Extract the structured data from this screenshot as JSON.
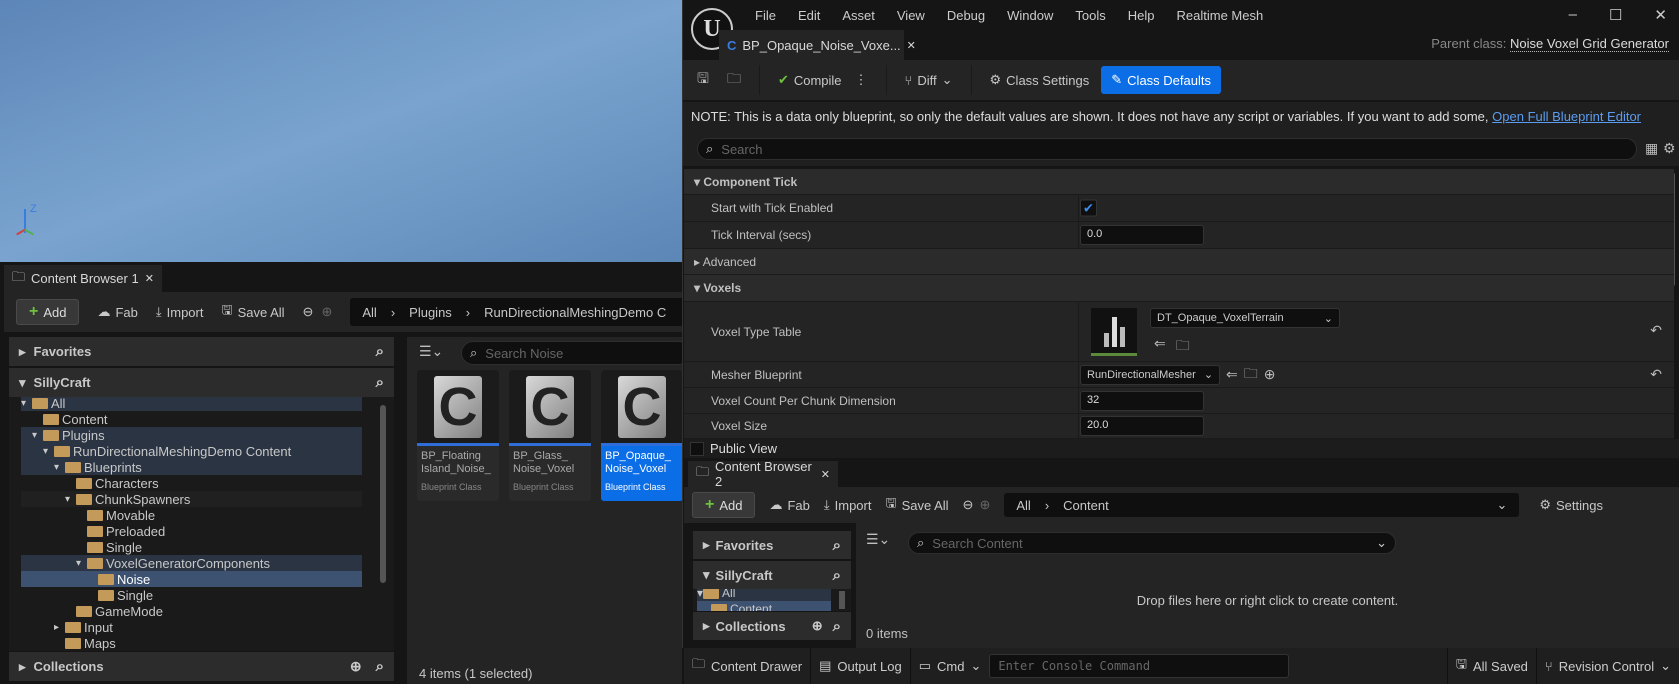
{
  "viewport": {
    "axis_label": "Z"
  },
  "cb1": {
    "tab": "Content Browser 1",
    "toolbar": {
      "add": "Add",
      "fab": "Fab",
      "import": "Import",
      "save_all": "Save All"
    },
    "breadcrumb": [
      "All",
      "Plugins",
      "RunDirectionalMeshingDemo C"
    ],
    "favorites": "Favorites",
    "project": "SillyCraft",
    "collections": "Collections",
    "tree": [
      {
        "label": "All",
        "depth": 0,
        "open": true,
        "hl": true
      },
      {
        "label": "Content",
        "depth": 1,
        "open": false,
        "hl": false
      },
      {
        "label": "Plugins",
        "depth": 1,
        "open": true,
        "hl": true
      },
      {
        "label": "RunDirectionalMeshingDemo Content",
        "depth": 2,
        "open": true,
        "hl": true
      },
      {
        "label": "Blueprints",
        "depth": 3,
        "open": true,
        "hl": true
      },
      {
        "label": "Characters",
        "depth": 4,
        "open": false,
        "hl": false
      },
      {
        "label": "ChunkSpawners",
        "depth": 4,
        "open": true,
        "hl": false,
        "dim": true
      },
      {
        "label": "Movable",
        "depth": 5,
        "open": false,
        "hl": false
      },
      {
        "label": "Preloaded",
        "depth": 5,
        "open": false,
        "hl": false
      },
      {
        "label": "Single",
        "depth": 5,
        "open": false,
        "hl": false
      },
      {
        "label": "VoxelGeneratorComponents",
        "depth": 5,
        "open": true,
        "hl": true
      },
      {
        "label": "Noise",
        "depth": 6,
        "open": false,
        "sel": true
      },
      {
        "label": "Single",
        "depth": 6,
        "open": false,
        "hl": false
      },
      {
        "label": "GameMode",
        "depth": 4,
        "open": false,
        "hl": false
      },
      {
        "label": "Input",
        "depth": 3,
        "open": false,
        "hl": false,
        "collapsed": true
      },
      {
        "label": "Maps",
        "depth": 3,
        "open": false,
        "hl": false
      }
    ],
    "search_placeholder": "Search Noise",
    "assets": [
      {
        "name": "BP_Floating Island_Noise_",
        "type": "Blueprint Class",
        "selected": false
      },
      {
        "name": "BP_Glass_ Noise_Voxel",
        "type": "Blueprint Class",
        "selected": false
      },
      {
        "name": "BP_Opaque_ Noise_Voxel",
        "type": "Blueprint Class",
        "selected": true
      }
    ],
    "status": "4 items (1 selected)"
  },
  "editor": {
    "menu": [
      "File",
      "Edit",
      "Asset",
      "View",
      "Debug",
      "Window",
      "Tools",
      "Help",
      "Realtime Mesh"
    ],
    "doc_tab": "BP_Opaque_Noise_Voxe...",
    "parent_label": "Parent class:",
    "parent_value": "Noise Voxel Grid Generator",
    "toolbar": {
      "compile": "Compile",
      "diff": "Diff",
      "class_settings": "Class Settings",
      "class_defaults": "Class Defaults"
    },
    "note": "NOTE: This is a data only blueprint, so only the default values are shown.  It does not have any script or variables.  If you want to add some,",
    "note_link": "Open Full Blueprint Editor",
    "search_placeholder": "Search",
    "sections": {
      "component_tick": "Component Tick",
      "advanced": "Advanced",
      "voxels": "Voxels"
    },
    "props": {
      "start_tick": {
        "label": "Start with Tick Enabled",
        "checked": true
      },
      "tick_interval": {
        "label": "Tick Interval (secs)",
        "value": "0.0"
      },
      "voxel_type_table": {
        "label": "Voxel Type Table",
        "value": "DT_Opaque_VoxelTerrain"
      },
      "mesher": {
        "label": "Mesher Blueprint",
        "value": "RunDirectionalMesher"
      },
      "voxel_count": {
        "label": "Voxel Count Per Chunk Dimension",
        "value": "32"
      },
      "voxel_size": {
        "label": "Voxel Size",
        "value": "20.0"
      }
    },
    "public_view": "Public View",
    "accent": "#0b6ee6"
  },
  "cb2": {
    "tab": "Content Browser 2",
    "toolbar": {
      "add": "Add",
      "fab": "Fab",
      "import": "Import",
      "save_all": "Save All",
      "settings": "Settings"
    },
    "breadcrumb": [
      "All",
      "Content"
    ],
    "favorites": "Favorites",
    "project": "SillyCraft",
    "collections": "Collections",
    "tree": [
      "All",
      "Content"
    ],
    "search_placeholder": "Search Content",
    "empty": "Drop files here or right click to create content.",
    "status": "0 items"
  },
  "statusbar": {
    "content_drawer": "Content Drawer",
    "output_log": "Output Log",
    "cmd": "Cmd",
    "console_placeholder": "Enter Console Command",
    "all_saved": "All Saved",
    "revision": "Revision Control"
  }
}
